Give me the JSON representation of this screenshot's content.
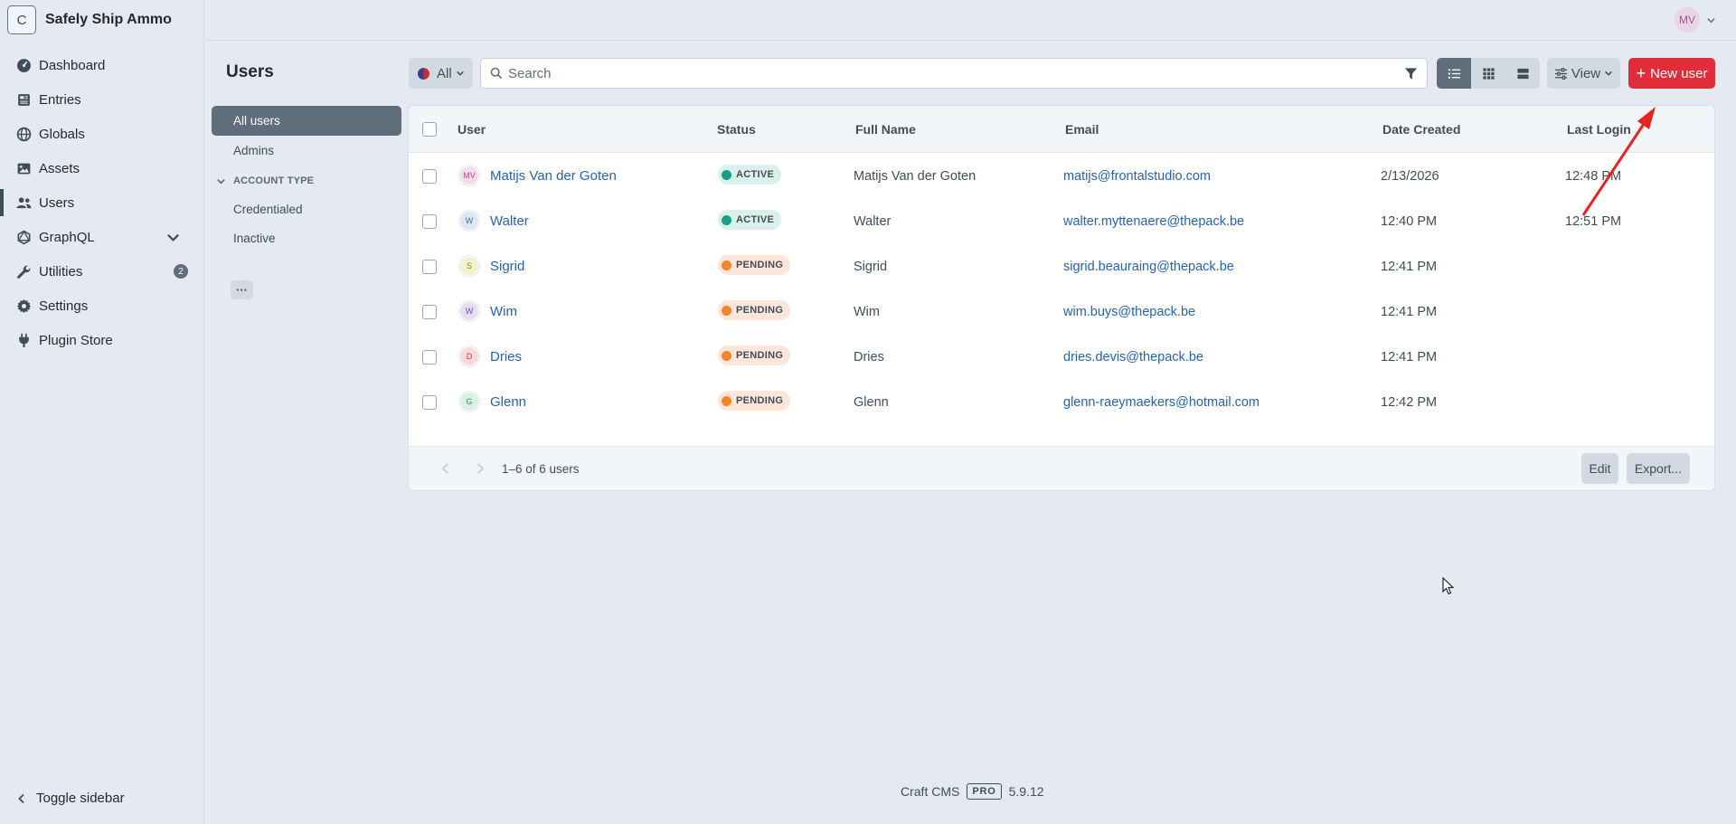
{
  "site": {
    "initial": "C",
    "name": "Safely Ship Ammo"
  },
  "nav": [
    {
      "label": "Dashboard",
      "icon": "gauge-icon"
    },
    {
      "label": "Entries",
      "icon": "newspaper-icon"
    },
    {
      "label": "Globals",
      "icon": "globe-icon"
    },
    {
      "label": "Assets",
      "icon": "image-icon"
    },
    {
      "label": "Users",
      "icon": "users-icon",
      "selected": true
    },
    {
      "label": "GraphQL",
      "icon": "graphql-icon"
    },
    {
      "label": "Utilities",
      "icon": "wrench-icon",
      "badge": "2"
    },
    {
      "label": "Settings",
      "icon": "gear-icon"
    },
    {
      "label": "Plugin Store",
      "icon": "plug-icon"
    }
  ],
  "toggle_sidebar": "Toggle sidebar",
  "user_avatar": "MV",
  "page_title": "Users",
  "sources": {
    "all_users": "All users",
    "admins": "Admins",
    "heading": "Account Type",
    "credentialed": "Credentialed",
    "inactive": "Inactive",
    "more": "···"
  },
  "toolbar": {
    "site_menu": "All",
    "search_placeholder": "Search",
    "view": "View",
    "new_user": "New user"
  },
  "table": {
    "headers": {
      "user": "User",
      "status": "Status",
      "full_name": "Full Name",
      "email": "Email",
      "date_created": "Date Created",
      "last_login": "Last Login"
    },
    "rows": [
      {
        "initials": "MV",
        "name": "Matijs Van der Goten",
        "status": "ACTIVE",
        "status_type": "active",
        "full_name": "Matijs Van der Goten",
        "email": "matijs@frontalstudio.com",
        "date_created": "2/13/2026",
        "last_login": "12:48 PM",
        "avatar_bg": "#f6dbe9",
        "avatar_fg": "#b5508a"
      },
      {
        "initials": "W",
        "name": "Walter",
        "status": "ACTIVE",
        "status_type": "active",
        "full_name": "Walter",
        "email": "walter.myttenaere@thepack.be",
        "date_created": "12:40 PM",
        "last_login": "12:51 PM",
        "avatar_bg": "#dde6f3",
        "avatar_fg": "#51688a"
      },
      {
        "initials": "S",
        "name": "Sigrid",
        "status": "PENDING",
        "status_type": "pending",
        "full_name": "Sigrid",
        "email": "sigrid.beauraing@thepack.be",
        "date_created": "12:41 PM",
        "last_login": "",
        "avatar_bg": "#f1f3cf",
        "avatar_fg": "#7e8530"
      },
      {
        "initials": "W",
        "name": "Wim",
        "status": "PENDING",
        "status_type": "pending",
        "full_name": "Wim",
        "email": "wim.buys@thepack.be",
        "date_created": "12:41 PM",
        "last_login": "",
        "avatar_bg": "#e8def4",
        "avatar_fg": "#7050a0"
      },
      {
        "initials": "D",
        "name": "Dries",
        "status": "PENDING",
        "status_type": "pending",
        "full_name": "Dries",
        "email": "dries.devis@thepack.be",
        "date_created": "12:41 PM",
        "last_login": "",
        "avatar_bg": "#fbdada",
        "avatar_fg": "#b34545"
      },
      {
        "initials": "G",
        "name": "Glenn",
        "status": "PENDING",
        "status_type": "pending",
        "full_name": "Glenn",
        "email": "glenn-raeymaekers@hotmail.com",
        "date_created": "12:42 PM",
        "last_login": "",
        "avatar_bg": "#d8f1e4",
        "avatar_fg": "#3f8a63"
      }
    ],
    "count": "1–6 of 6 users",
    "edit": "Edit",
    "export": "Export..."
  },
  "footer": {
    "product": "Craft CMS",
    "edition": "PRO",
    "version": "5.9.12"
  },
  "colors": {
    "accent": "#e12d39",
    "link": "#2563b5",
    "active": "#16a085",
    "pending": "#f2842a"
  }
}
